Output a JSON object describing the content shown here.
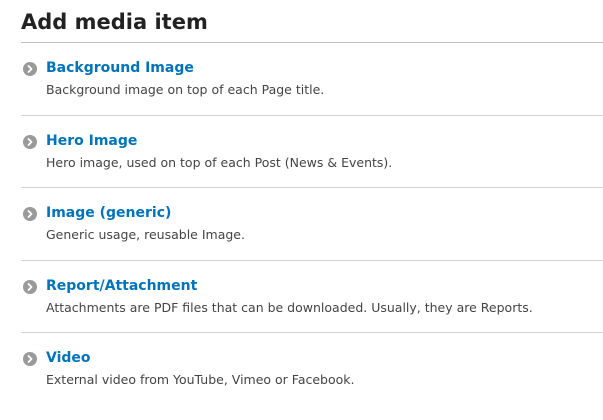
{
  "page": {
    "title": "Add media item"
  },
  "media_types": [
    {
      "label": "Background Image",
      "description": "Background image on top of each Page title.",
      "icon": "chevron-right-icon"
    },
    {
      "label": "Hero Image",
      "description": "Hero image, used on top of each Post (News & Events).",
      "icon": "chevron-right-icon"
    },
    {
      "label": "Image (generic)",
      "description": "Generic usage, reusable Image.",
      "icon": "chevron-right-icon"
    },
    {
      "label": "Report/Attachment",
      "description": "Attachments are PDF files that can be downloaded. Usually, they are Reports.",
      "icon": "chevron-right-icon"
    },
    {
      "label": "Video",
      "description": "External video from YouTube, Vimeo or Facebook.",
      "icon": "chevron-right-icon"
    }
  ],
  "colors": {
    "link": "#0074bd",
    "icon": "#9a9a9a",
    "divider": "#d3d3d3"
  }
}
